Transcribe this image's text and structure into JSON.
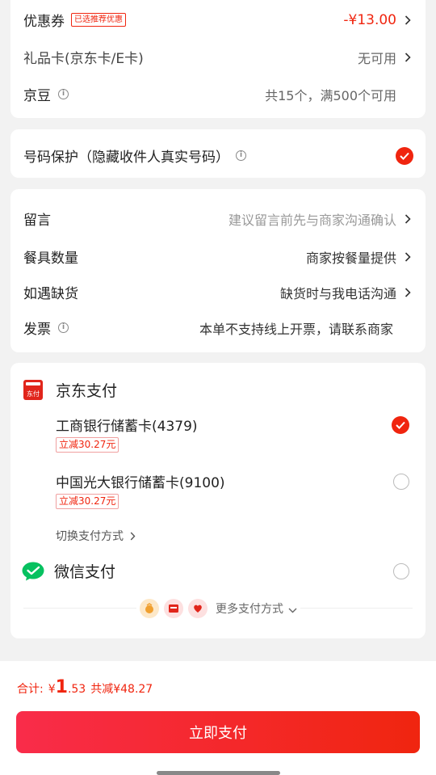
{
  "discounts": {
    "coupon_label": "优惠券",
    "coupon_tag": "已选推荐优惠",
    "coupon_value": "-¥13.00",
    "giftcard_label": "礼品卡(京东卡/E卡)",
    "giftcard_value": "无可用",
    "jingdou_label": "京豆",
    "jingdou_value": "共15个，满500个可用"
  },
  "privacy": {
    "label": "号码保护（隐藏收件人真实号码）"
  },
  "order_options": {
    "message_label": "留言",
    "message_placeholder": "建议留言前先与商家沟通确认",
    "tableware_label": "餐具数量",
    "tableware_value": "商家按餐量提供",
    "outofstock_label": "如遇缺货",
    "outofstock_value": "缺货时与我电话沟通",
    "invoice_label": "发票",
    "invoice_value": "本单不支持线上开票，请联系商家"
  },
  "payment": {
    "jd_pay_label": "京东支付",
    "jd_pay_icon_text": "东付",
    "cards": [
      {
        "name": "工商银行储蓄卡(4379)",
        "discount": "立减30.27元",
        "selected": true
      },
      {
        "name": "中国光大银行储蓄卡(9100)",
        "discount": "立减30.27元",
        "selected": false
      }
    ],
    "switch_label": "切换支付方式",
    "wechat_label": "微信支付",
    "more_label": "更多支付方式"
  },
  "footer": {
    "total_label": "合计:",
    "currency": "¥",
    "amount_int": "1",
    "amount_dec": ".53",
    "saved_text": "共减¥48.27",
    "pay_button": "立即支付"
  },
  "colors": {
    "accent": "#f0250f",
    "wechat": "#07c160"
  }
}
